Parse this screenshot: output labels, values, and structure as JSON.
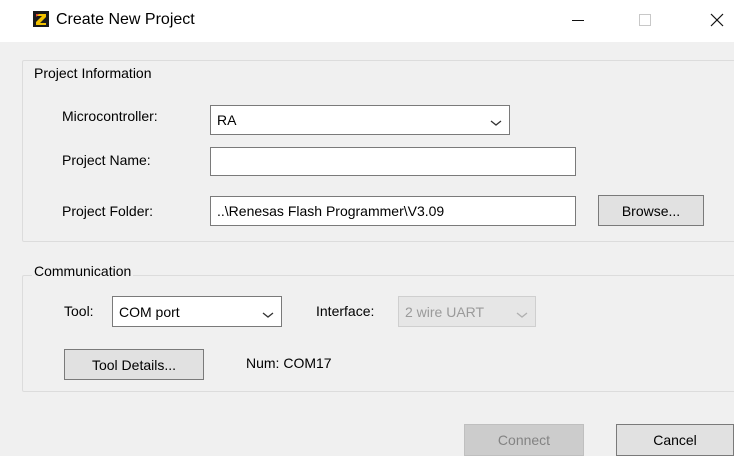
{
  "window": {
    "title": "Create New Project",
    "icon": "renesas-flash-programmer-icon",
    "controls": {
      "minimize": "minimize-icon",
      "maximize": "maximize-icon",
      "close": "close-icon"
    }
  },
  "project_information": {
    "group_label": "Project Information",
    "microcontroller_label": "Microcontroller:",
    "microcontroller_value": "RA",
    "project_name_label": "Project Name:",
    "project_name_value": "",
    "project_folder_label": "Project Folder:",
    "project_folder_value": "..\\Renesas Flash Programmer\\V3.09",
    "browse_label": "Browse..."
  },
  "communication": {
    "group_label": "Communication",
    "tool_label": "Tool:",
    "tool_value": "COM port",
    "interface_label": "Interface:",
    "interface_value": "2 wire UART",
    "tool_details_label": "Tool Details...",
    "num_text": "Num: COM17"
  },
  "footer": {
    "connect_label": "Connect",
    "cancel_label": "Cancel"
  },
  "colors": {
    "background": "#f0f0f0",
    "titlebar": "#ffffff",
    "disabled_text": "#838383"
  }
}
